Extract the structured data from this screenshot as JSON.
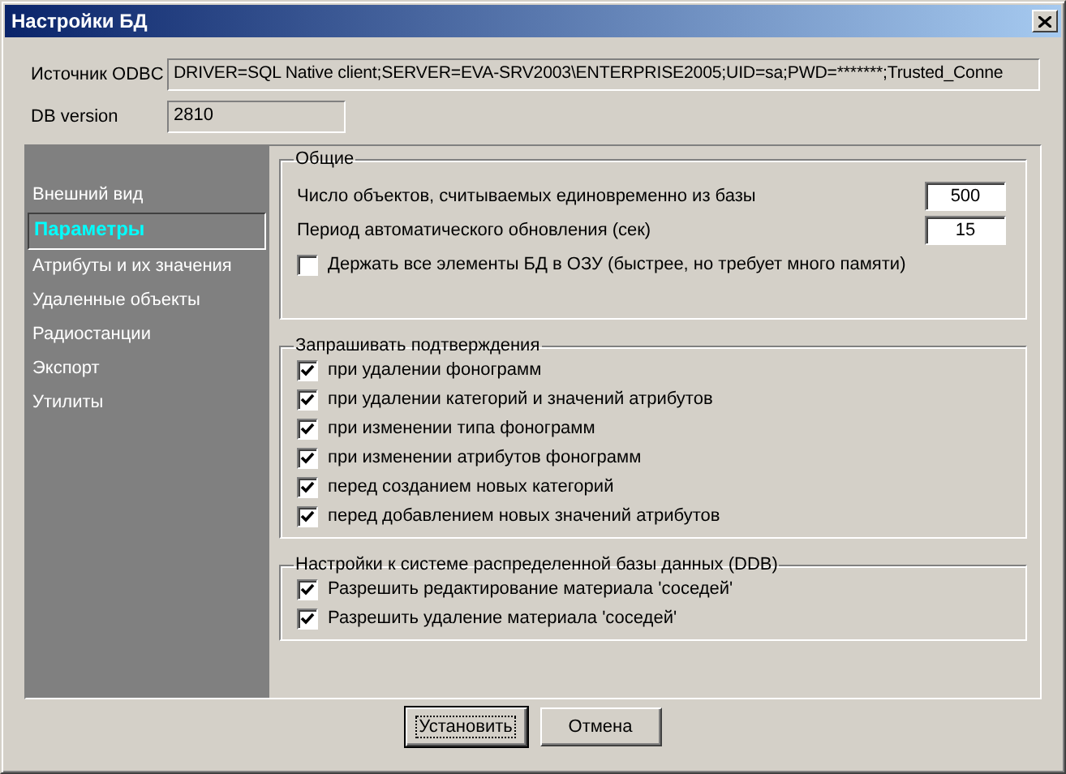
{
  "window": {
    "title": "Настройки БД"
  },
  "source": {
    "label": "Источник ODBC",
    "value": "DRIVER=SQL Native client;SERVER=EVA-SRV2003\\ENTERPRISE2005;UID=sa;PWD=*******;Trusted_Conne"
  },
  "db_version": {
    "label": "DB version",
    "value": "2810"
  },
  "sidebar": {
    "items": [
      {
        "label": "Внешний вид",
        "selected": false
      },
      {
        "label": "Параметры",
        "selected": true
      },
      {
        "label": "Атрибуты и их значения",
        "selected": false
      },
      {
        "label": "Удаленные объекты",
        "selected": false
      },
      {
        "label": "Радиостанции",
        "selected": false
      },
      {
        "label": "Экспорт",
        "selected": false
      },
      {
        "label": "Утилиты",
        "selected": false
      }
    ]
  },
  "groups": [
    {
      "title": "Общие",
      "items": [
        {
          "kind": "number",
          "label": "Число объектов, считываемых единовременно из базы",
          "value": "500"
        },
        {
          "kind": "number",
          "label": "Период автоматического обновления (сек)",
          "value": "15"
        },
        {
          "kind": "checkbox",
          "label": "Держать все элементы БД в ОЗУ (быстрее, но требует много памяти)",
          "checked": false
        }
      ]
    },
    {
      "title": "Запрашивать подтверждения",
      "items": [
        {
          "kind": "checkbox",
          "label": "при удалении фонограмм",
          "checked": true
        },
        {
          "kind": "checkbox",
          "label": "при удалении категорий и значений атрибутов",
          "checked": true
        },
        {
          "kind": "checkbox",
          "label": "при изменении типа фонограмм",
          "checked": true
        },
        {
          "kind": "checkbox",
          "label": "при изменении атрибутов фонограмм",
          "checked": true
        },
        {
          "kind": "checkbox",
          "label": "перед созданием новых категорий",
          "checked": true
        },
        {
          "kind": "checkbox",
          "label": "перед добавлением новых значений атрибутов",
          "checked": true
        }
      ]
    },
    {
      "title": "Настройки к системе распределенной базы данных (DDB)",
      "items": [
        {
          "kind": "checkbox",
          "label": "Разрешить редактирование материала 'соседей'",
          "checked": true
        },
        {
          "kind": "checkbox",
          "label": "Разрешить удаление материала 'соседей'",
          "checked": true
        }
      ]
    }
  ],
  "buttons": [
    {
      "label": "Установить",
      "focused": true
    },
    {
      "label": "Отмена",
      "focused": false
    }
  ]
}
